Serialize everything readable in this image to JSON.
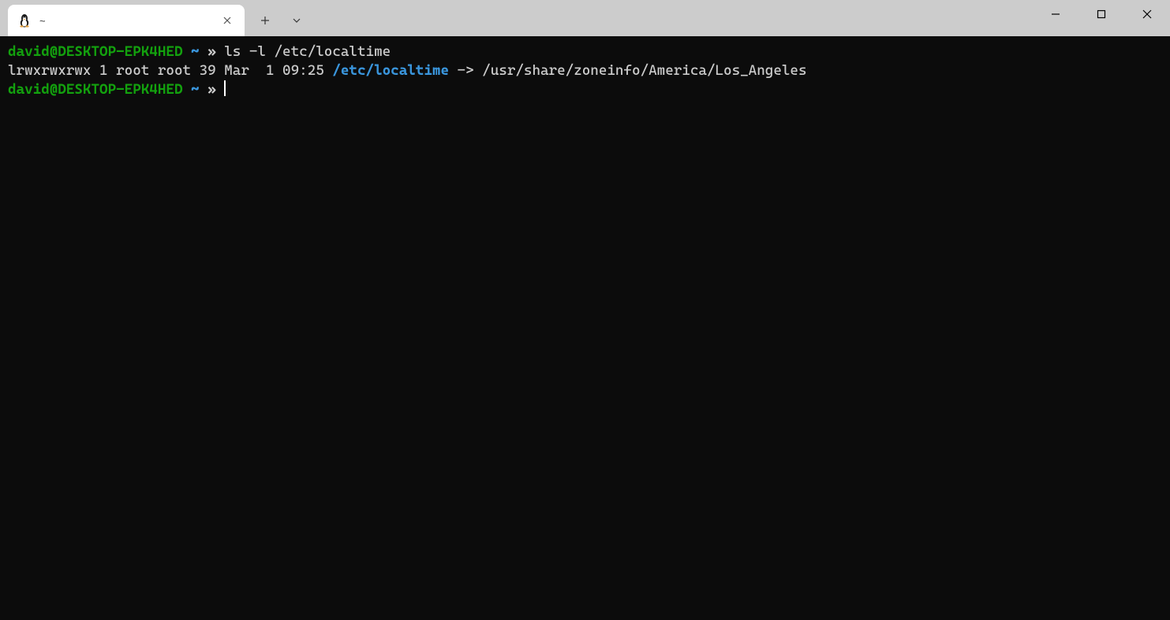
{
  "titlebar": {
    "tab": {
      "title": "~"
    }
  },
  "terminal": {
    "line1": {
      "user": "david@DESKTOP-EPK4HED",
      "path": "~",
      "symbol": "»",
      "command": "ls -l /etc/localtime"
    },
    "line2": {
      "perms": "lrwxrwxrwx 1 root root 39 Mar  1 09:25 ",
      "linkname": "/etc/localtime",
      "arrow": " -> ",
      "target": "/usr/share/zoneinfo/America/Los_Angeles"
    },
    "line3": {
      "user": "david@DESKTOP-EPK4HED",
      "path": "~",
      "symbol": "»"
    }
  }
}
